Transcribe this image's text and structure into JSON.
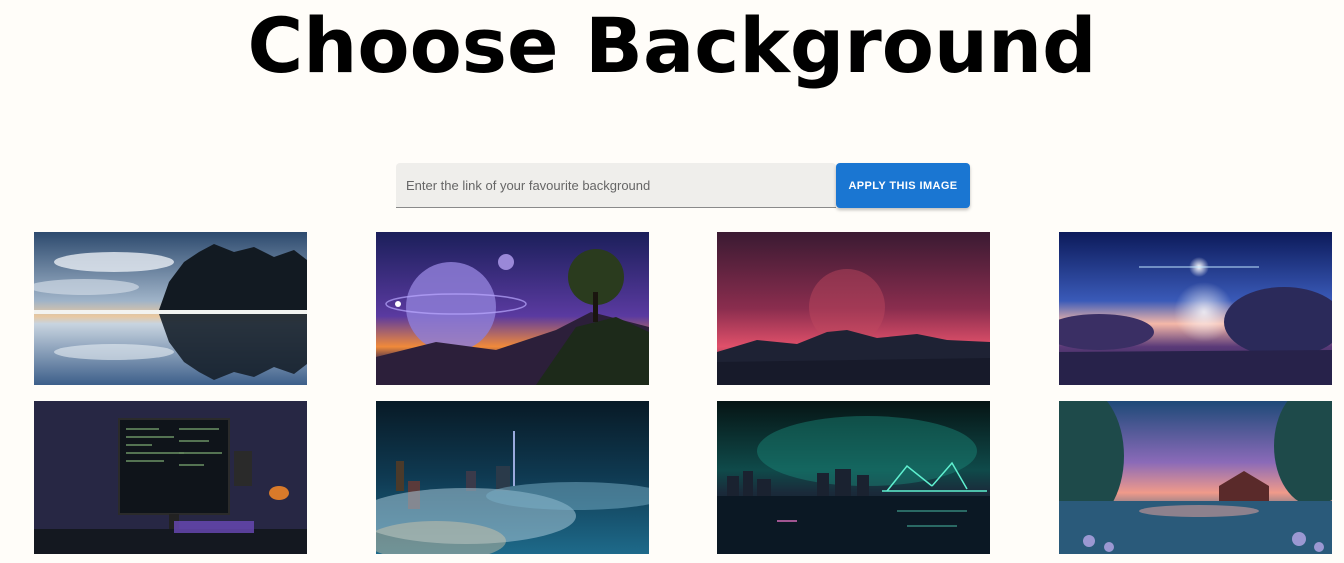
{
  "page": {
    "title": "Choose Background"
  },
  "form": {
    "placeholder": "Enter the link of your favourite background",
    "value": "",
    "apply_label": "APPLY THIS IMAGE"
  },
  "colors": {
    "accent": "#1a76d2",
    "page_background": "#fffdf9"
  },
  "backgrounds": [
    {
      "name": "lake-forest-reflection"
    },
    {
      "name": "planet-sunset-tree"
    },
    {
      "name": "moon-mountain-pink-sky"
    },
    {
      "name": "star-cloud-sunrise"
    },
    {
      "name": "coding-desk-setup"
    },
    {
      "name": "foggy-city-night"
    },
    {
      "name": "neon-bridge-city"
    },
    {
      "name": "fantasy-lake-cottage"
    }
  ]
}
